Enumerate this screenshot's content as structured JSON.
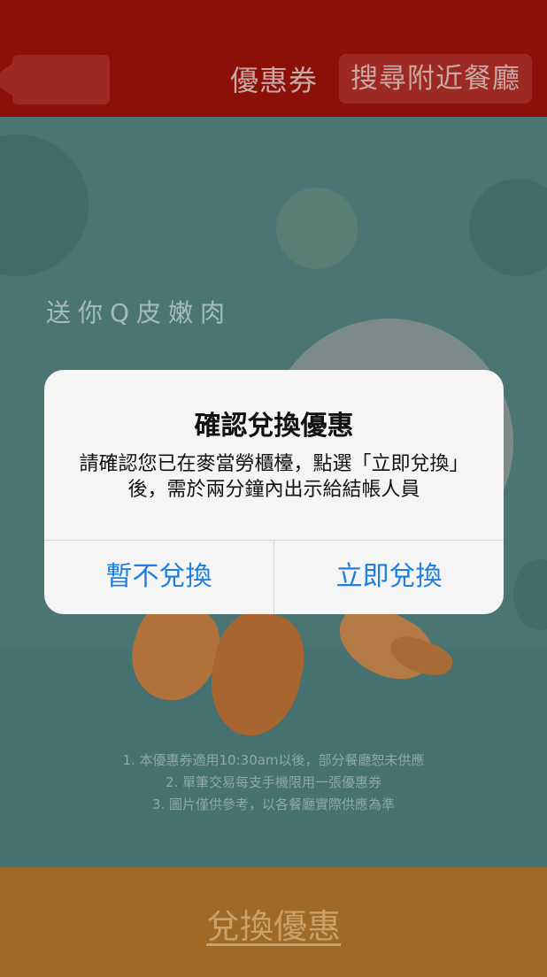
{
  "header": {
    "title": "優惠券",
    "search_button": "搜尋附近餐廳",
    "colors": {
      "background": "#8a1008",
      "button": "#9c2a22"
    }
  },
  "coupon": {
    "promo_text": "送你Q皮嫩肉",
    "notes": [
      "1. 本優惠券適用10:30am以後，部分餐廳恕未供應",
      "2. 單筆交易每支手機限用一張優惠券",
      "3. 圖片僅供參考，以各餐廳實際供應為準"
    ],
    "colors": {
      "background": "#4b7572"
    }
  },
  "redeem_bar": {
    "label": "兌換優惠",
    "colors": {
      "background": "#9e6a25"
    }
  },
  "dialog": {
    "title": "確認兌換優惠",
    "message": "請確認您已在麥當勞櫃檯，點選「立即兌換」後，需於兩分鐘內出示給結帳人員",
    "cancel_label": "暫不兌換",
    "confirm_label": "立即兌換",
    "colors": {
      "button_text": "#1f7fe0"
    }
  }
}
